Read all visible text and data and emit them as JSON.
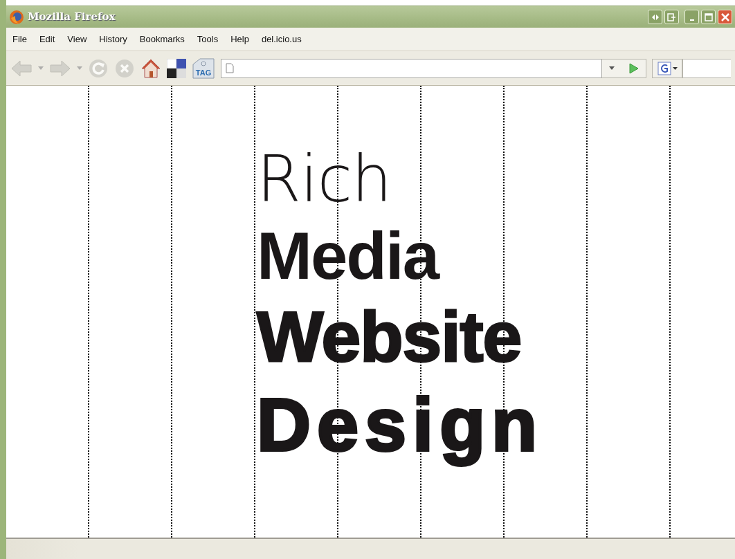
{
  "window": {
    "title": "Mozilla Firefox"
  },
  "menu": [
    {
      "label": "File"
    },
    {
      "label": "Edit"
    },
    {
      "label": "View"
    },
    {
      "label": "History"
    },
    {
      "label": "Bookmarks"
    },
    {
      "label": "Tools"
    },
    {
      "label": "Help"
    },
    {
      "label": "del.icio.us"
    }
  ],
  "toolbar": [
    {
      "kind": "back",
      "disabled": true
    },
    {
      "kind": "caret",
      "disabled": true
    },
    {
      "kind": "forward",
      "disabled": true
    },
    {
      "kind": "caret",
      "disabled": true
    },
    {
      "kind": "reload",
      "disabled": true
    },
    {
      "kind": "stop",
      "disabled": true
    },
    {
      "kind": "home",
      "disabled": false
    },
    {
      "kind": "squares",
      "disabled": false
    },
    {
      "kind": "tag",
      "disabled": false
    }
  ],
  "tag_label": "TAG",
  "headline": [
    {
      "text": "Rich",
      "kind": "light"
    },
    {
      "text": "Media",
      "kind": "bold"
    },
    {
      "text": "Website",
      "kind": "black"
    },
    {
      "text": "Design",
      "kind": "wide"
    }
  ]
}
